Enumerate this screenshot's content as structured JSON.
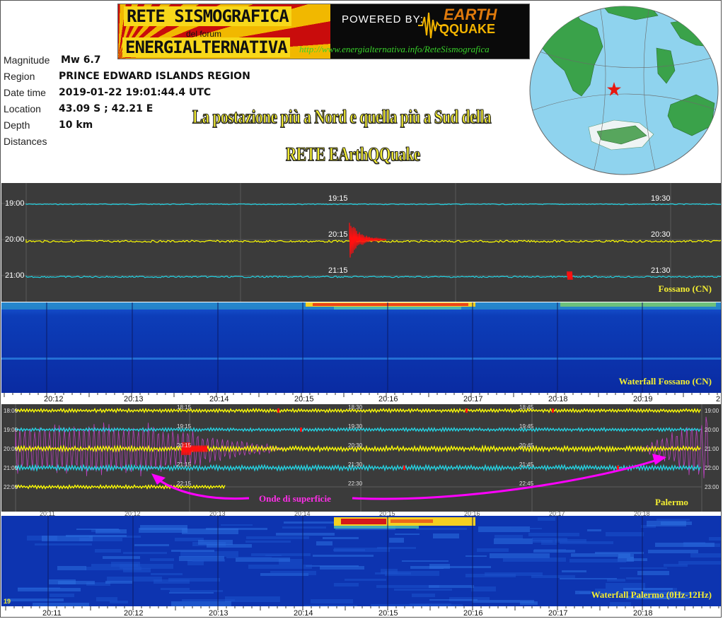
{
  "banner": {
    "line1": "RETE SISMOGRAFICA",
    "line2": "del forum",
    "line3": "ENERGIALTERNATIVA",
    "powered_by": "POWERED BY:",
    "logo_top": "EARTH",
    "logo_bottom": "QQUAKE",
    "url": "http://www.energialternativa.info/ReteSismografica"
  },
  "event": {
    "magnitude_label": "Magnitude",
    "magnitude": "Mw 6.7",
    "region_label": "Region",
    "region": "PRINCE EDWARD ISLANDS REGION",
    "datetime_label": "Date time",
    "datetime": "2019-01-22 19:01:44.4 UTC",
    "location_label": "Location",
    "location": "43.09 S ; 42.21 E",
    "depth_label": "Depth",
    "depth": "10 km",
    "distances_label": "Distances"
  },
  "note": {
    "line1": "La postazione più a Nord e quella più a Sud della",
    "line2": "RETE EArthQQuake"
  },
  "colors": {
    "yellow_trace": "#ffff00",
    "cyan_trace": "#21d4e4",
    "event_red": "#ff1010",
    "surface_wave": "#d243d6",
    "arrow": "#ff00ff"
  },
  "fossano": {
    "caption": "Fossano (CN)",
    "rows": [
      {
        "label": "19:00",
        "mid": "19:15",
        "right": "19:30"
      },
      {
        "label": "20:00",
        "mid": "20:15",
        "right": "20:30"
      },
      {
        "label": "21:00",
        "mid": "21:15",
        "right": "21:30"
      }
    ]
  },
  "waterfall_fossano": {
    "caption": "Waterfall Fossano (CN)",
    "ticks": [
      "20:12",
      "20:13",
      "20:14",
      "20:15",
      "20:16",
      "20:17",
      "20:18",
      "20:19",
      "2"
    ]
  },
  "palermo": {
    "caption": "Palermo",
    "annotation": "Onde di superficie",
    "left_labels": [
      "18:00",
      "19:00",
      "20:00",
      "21:00",
      "22:00"
    ],
    "right_labels": [
      "19:00",
      "20:00",
      "21:00",
      "22:00",
      "23:00"
    ],
    "inner_labels": [
      [
        "18:15",
        "18:30",
        "18:45"
      ],
      [
        "19:15",
        "19:30",
        "19:45"
      ],
      [
        "20:15",
        "20:30",
        "20:45"
      ],
      [
        "21:15",
        "21:30",
        "21:45"
      ],
      [
        "22:15",
        "22:30",
        "22:45"
      ]
    ],
    "top_ticks": [
      "20:11",
      "20:12",
      "20:13",
      "20:14",
      "20:15",
      "20:16",
      "20:17",
      "20:18"
    ]
  },
  "waterfall_palermo": {
    "caption": "Waterfall Palermo (0Hz-12Hz)",
    "corner": "19",
    "ticks": [
      "20:11",
      "20:12",
      "20:13",
      "20:14",
      "20:15",
      "20:16",
      "20:17",
      "20:18"
    ]
  }
}
